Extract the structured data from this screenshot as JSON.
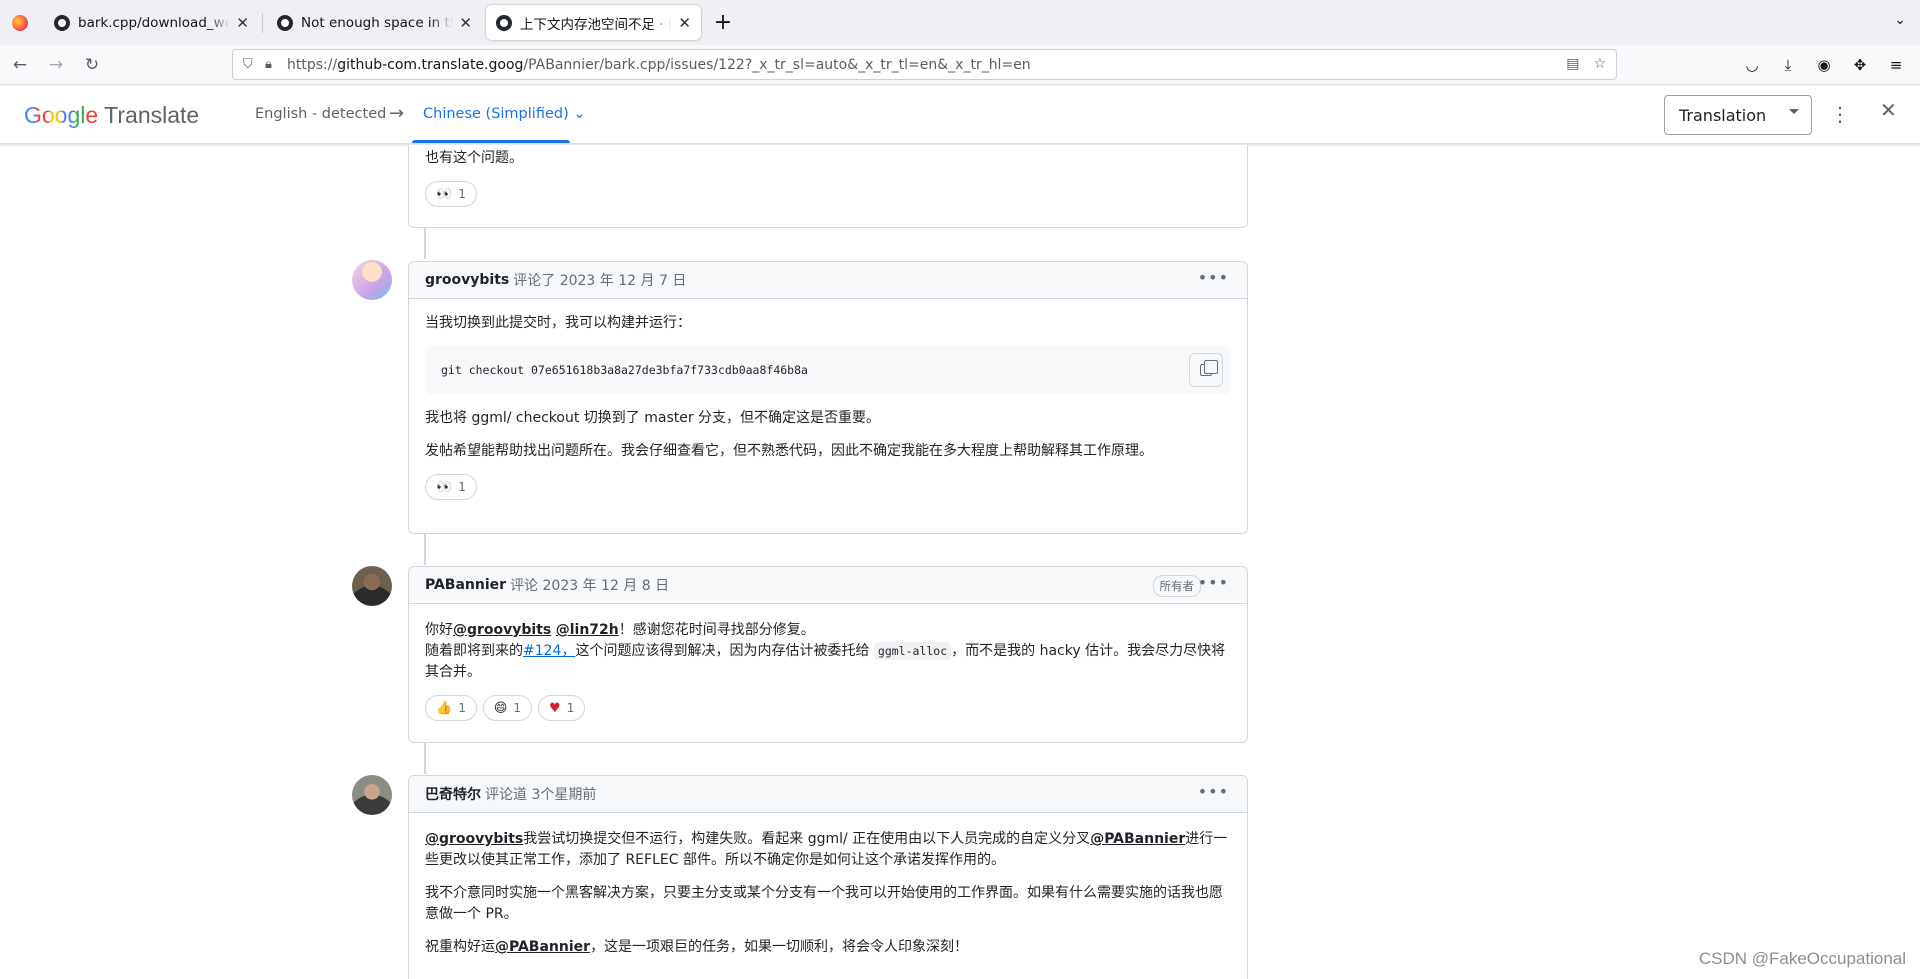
{
  "browser": {
    "tabs": [
      {
        "title": "bark.cpp/download_weigh",
        "active": false
      },
      {
        "title": "Not enough space in the c",
        "active": false
      },
      {
        "title": "上下文内存池空间不足 · 问题",
        "active": true
      }
    ],
    "url_prefix": "https://",
    "url_host": "github-com.translate.goog",
    "url_path": "/PABannier/bark.cpp/issues/122?_x_tr_sl=auto&_x_tr_tl=en&_x_tr_hl=en"
  },
  "translate_bar": {
    "logo_google": "Google",
    "logo_translate": "Translate",
    "source_lang": "English - detected",
    "target_lang": "Chinese (Simplified)",
    "mode": "Translation"
  },
  "comments": [
    {
      "body_partial": "也有这个问题。",
      "reactions": [
        {
          "emoji": "👀",
          "count": "1"
        }
      ]
    },
    {
      "author": "groovybits",
      "meta": "评论了 2023 年 12 月 7 日",
      "p1": "当我切换到此提交时，我可以构建并运行：",
      "code": "git checkout 07e651618b3a8a27de3bfa7f733cdb0aa8f46b8a",
      "p2": "我也将 ggml/ checkout 切换到了 master 分支，但不确定这是否重要。",
      "p3": "发帖希望能帮助找出问题所在。我会仔细查看它，但不熟悉代码，因此不确定我能在多大程度上帮助解释其工作原理。",
      "reactions": [
        {
          "emoji": "👀",
          "count": "1"
        }
      ]
    },
    {
      "author": "PABannier",
      "meta": "评论 2023 年 12 月 8 日",
      "badge": "所有者",
      "greet_pre": "你好",
      "mention1": "@groovybits",
      "mention2": "@lin72h",
      "greet_post": "！感谢您花时间寻找部分修复。",
      "line2_pre": "随着即将到来的",
      "issue_link": "#124，",
      "line2_mid": "这个问题应该得到解决，因为内存估计被委托给",
      "inline_code": "ggml-alloc",
      "line2_post": "，而不是我的 hacky 估计。我会尽力尽快将其合并。",
      "reactions": [
        {
          "emoji": "👍",
          "count": "1"
        },
        {
          "emoji": "😄",
          "count": "1"
        },
        {
          "emoji": "❤️",
          "count": "1"
        }
      ]
    },
    {
      "author": "巴奇特尔",
      "meta": "评论道 3个星期前",
      "m1": "@groovybits",
      "p1_mid": "我尝试切换提交但不运行，构建失败。看起来 ggml/ 正在使用由以下人员完成的自定义分叉",
      "m2": "@PABannier",
      "p1_post": "进行一些更改以使其正常工作，添加了 REFLEC 部件。所以不确定你是如何让这个承诺发挥作用的。",
      "p2": "我不介意同时实施一个黑客解决方案，只要主分支或某个分支有一个我可以开始使用的工作界面。如果有什么需要实施的话我也愿意做一个 PR。",
      "p3_pre": "祝重构好运",
      "m3": "@PABannier",
      "p3_post": "，这是一项艰巨的任务，如果一切顺利，将会令人印象深刻！"
    }
  ],
  "watermark": "CSDN @FakeOccupational"
}
